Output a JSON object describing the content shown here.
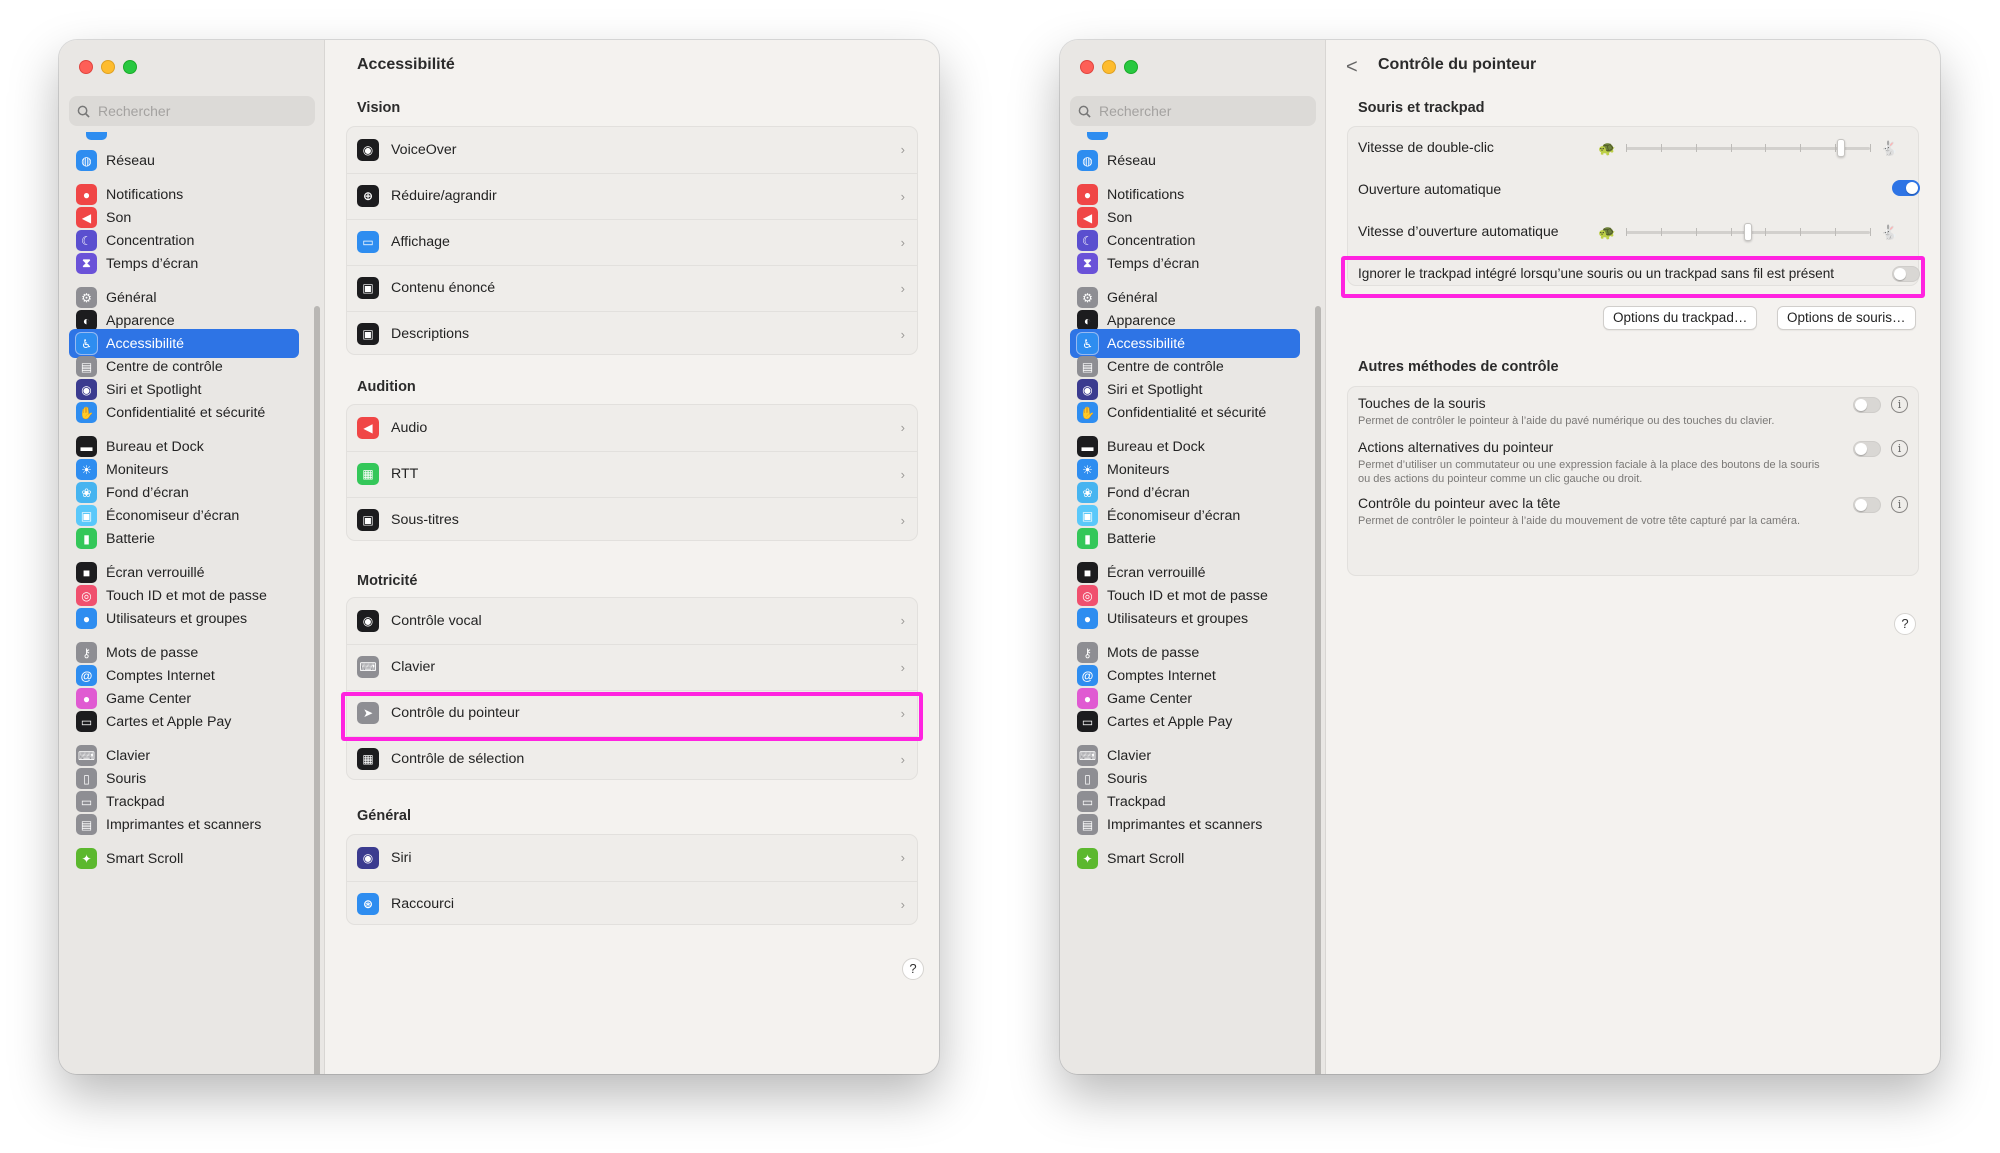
{
  "sidebar": {
    "search_placeholder": "Rechercher",
    "items": [
      {
        "label": "Réseau",
        "icon": "globe-icon",
        "color": "#2e8df0"
      },
      {
        "label": "Notifications",
        "icon": "bell-icon",
        "color": "#f04646"
      },
      {
        "label": "Son",
        "icon": "speaker-icon",
        "color": "#f04646"
      },
      {
        "label": "Concentration",
        "icon": "moon-icon",
        "color": "#5a4fcf"
      },
      {
        "label": "Temps d’écran",
        "icon": "hourglass-icon",
        "color": "#6a52d8"
      },
      {
        "label": "Général",
        "icon": "gear-icon",
        "color": "#8e8e93"
      },
      {
        "label": "Apparence",
        "icon": "appearance-icon",
        "color": "#1c1c1e"
      },
      {
        "label": "Accessibilité",
        "icon": "accessibility-icon",
        "color": "#2e8df0"
      },
      {
        "label": "Centre de contrôle",
        "icon": "control-center-icon",
        "color": "#8e8e93"
      },
      {
        "label": "Siri et Spotlight",
        "icon": "siri-icon",
        "color": "#3b3b8f"
      },
      {
        "label": "Confidentialité et sécurité",
        "icon": "hand-icon",
        "color": "#2e8df0"
      },
      {
        "label": "Bureau et Dock",
        "icon": "dock-icon",
        "color": "#1c1c1e"
      },
      {
        "label": "Moniteurs",
        "icon": "sun-icon",
        "color": "#2e8df0"
      },
      {
        "label": "Fond d’écran",
        "icon": "wallpaper-icon",
        "color": "#46b4f0"
      },
      {
        "label": "Économiseur d’écran",
        "icon": "screensaver-icon",
        "color": "#5ac8fa"
      },
      {
        "label": "Batterie",
        "icon": "battery-icon",
        "color": "#34c759"
      },
      {
        "label": "Écran verrouillé",
        "icon": "lock-icon",
        "color": "#1c1c1e"
      },
      {
        "label": "Touch ID et mot de passe",
        "icon": "fingerprint-icon",
        "color": "#f0506e"
      },
      {
        "label": "Utilisateurs et groupes",
        "icon": "users-icon",
        "color": "#2e8df0"
      },
      {
        "label": "Mots de passe",
        "icon": "key-icon",
        "color": "#8e8e93"
      },
      {
        "label": "Comptes Internet",
        "icon": "at-icon",
        "color": "#2e8df0"
      },
      {
        "label": "Game Center",
        "icon": "game-center-icon",
        "color": "#e05ad2"
      },
      {
        "label": "Cartes et Apple Pay",
        "icon": "wallet-icon",
        "color": "#1c1c1e"
      },
      {
        "label": "Clavier",
        "icon": "keyboard-icon",
        "color": "#8e8e93"
      },
      {
        "label": "Souris",
        "icon": "mouse-icon",
        "color": "#8e8e93"
      },
      {
        "label": "Trackpad",
        "icon": "trackpad-icon",
        "color": "#8e8e93"
      },
      {
        "label": "Imprimantes et scanners",
        "icon": "printer-icon",
        "color": "#8e8e93"
      },
      {
        "label": "Smart Scroll",
        "icon": "smart-scroll-icon",
        "color": "#5cb82e"
      }
    ]
  },
  "left_pane": {
    "title": "Accessibilité",
    "sections": [
      {
        "heading": "Vision",
        "rows": [
          {
            "label": "VoiceOver",
            "icon": "voiceover-icon",
            "color": "#1c1c1e"
          },
          {
            "label": "Réduire/agrandir",
            "icon": "zoom-icon",
            "color": "#1c1c1e"
          },
          {
            "label": "Affichage",
            "icon": "display-icon",
            "color": "#2e8df0"
          },
          {
            "label": "Contenu énoncé",
            "icon": "spoken-content-icon",
            "color": "#1c1c1e"
          },
          {
            "label": "Descriptions",
            "icon": "descriptions-icon",
            "color": "#1c1c1e"
          }
        ]
      },
      {
        "heading": "Audition",
        "rows": [
          {
            "label": "Audio",
            "icon": "audio-icon",
            "color": "#f04646"
          },
          {
            "label": "RTT",
            "icon": "rtt-icon",
            "color": "#34c759"
          },
          {
            "label": "Sous-titres",
            "icon": "subtitles-icon",
            "color": "#1c1c1e"
          }
        ]
      },
      {
        "heading": "Motricité",
        "rows": [
          {
            "label": "Contrôle vocal",
            "icon": "voice-control-icon",
            "color": "#1c1c1e"
          },
          {
            "label": "Clavier",
            "icon": "keyboard-icon",
            "color": "#8e8e93"
          },
          {
            "label": "Contrôle du pointeur",
            "icon": "pointer-icon",
            "color": "#8e8e93"
          },
          {
            "label": "Contrôle de sélection",
            "icon": "switch-control-icon",
            "color": "#1c1c1e"
          }
        ]
      },
      {
        "heading": "Général",
        "rows": [
          {
            "label": "Siri",
            "icon": "siri-icon",
            "color": "#3b3b8f"
          },
          {
            "label": "Raccourci",
            "icon": "shortcut-icon",
            "color": "#2e8df0"
          }
        ]
      }
    ],
    "help": "?"
  },
  "right_pane": {
    "title": "Contrôle du pointeur",
    "back": "<",
    "section1": "Souris et trackpad",
    "double_click_label": "Vitesse de double-clic",
    "double_click_level": 0.88,
    "spring_loading_label": "Ouverture automatique",
    "spring_loading_on": true,
    "spring_speed_label": "Vitesse d’ouverture automatique",
    "spring_speed_level": 0.5,
    "ignore_trackpad_label": "Ignorer le trackpad intégré lorsqu’une souris ou un trackpad sans fil est présent",
    "ignore_trackpad_on": false,
    "trackpad_options": "Options du trackpad…",
    "mouse_options": "Options de souris…",
    "section2": "Autres méthodes de contrôle",
    "other_methods": [
      {
        "title": "Touches de la souris",
        "desc": "Permet de contrôler le pointeur à l’aide du pavé numérique ou des touches du clavier.",
        "on": false
      },
      {
        "title": "Actions alternatives du pointeur",
        "desc": "Permet d’utiliser un commutateur ou une expression faciale à la place des boutons de la souris ou des actions du pointeur comme un clic gauche ou droit.",
        "on": false
      },
      {
        "title": "Contrôle du pointeur avec la tête",
        "desc": "Permet de contrôler le pointeur à l’aide du mouvement de votre tête capturé par la caméra.",
        "on": false
      }
    ],
    "help": "?"
  },
  "colors": {
    "accent": "#2e74e5",
    "highlight": "#ff23e0"
  }
}
